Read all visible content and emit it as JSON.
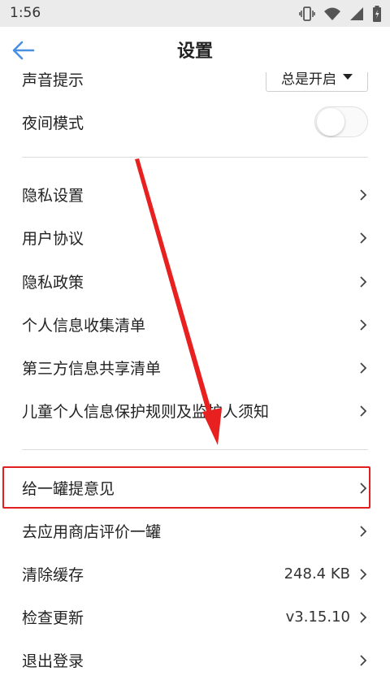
{
  "status_bar": {
    "time": "1:56"
  },
  "app_bar": {
    "title": "设置"
  },
  "settings": {
    "sound": {
      "label": "声音提示",
      "value": "总是开启"
    },
    "night_mode": {
      "label": "夜间模式"
    },
    "group1": [
      {
        "label": "隐私设置"
      },
      {
        "label": "用户协议"
      },
      {
        "label": "隐私政策"
      },
      {
        "label": "个人信息收集清单"
      },
      {
        "label": "第三方信息共享清单"
      },
      {
        "label": "儿童个人信息保护规则及监护人须知"
      }
    ],
    "group2": [
      {
        "label": "给一罐提意见"
      },
      {
        "label": "去应用商店评价一罐"
      },
      {
        "label": "清除缓存",
        "value": "248.4 KB"
      },
      {
        "label": "检查更新",
        "value": "v3.15.10"
      },
      {
        "label": "退出登录"
      }
    ]
  },
  "colors": {
    "highlight": "#e02020",
    "accent": "#4a90e2"
  }
}
